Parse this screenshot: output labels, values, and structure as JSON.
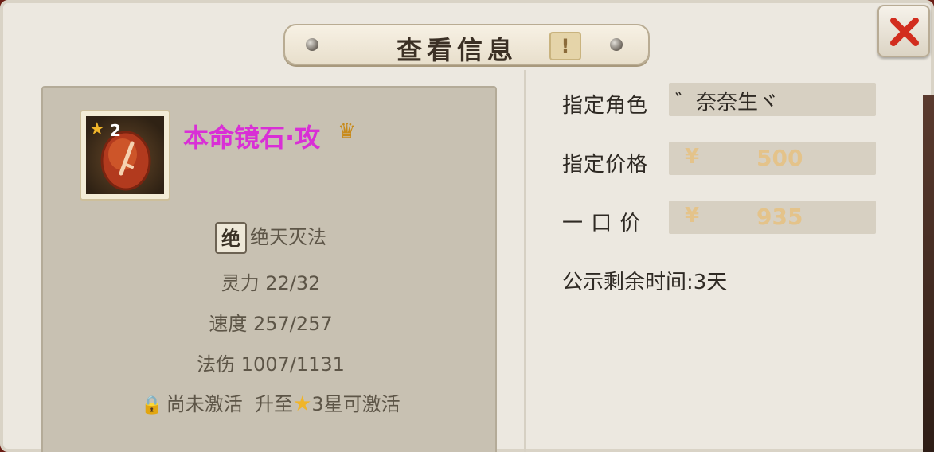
{
  "title": {
    "text": "查看信息",
    "info_symbol": "!"
  },
  "close_button": {
    "symbol": "✕",
    "color": "#d22d1e"
  },
  "item": {
    "name": "本命镜石·攻",
    "name_color": "#d92fd6",
    "star_level": "2",
    "icon": "sword-gem-icon",
    "crown_icon": "crown-icon"
  },
  "skill": {
    "badge": "绝",
    "name": "绝天灭法"
  },
  "stats": {
    "spirit": "灵力 22/32",
    "speed": "速度 257/257",
    "magic_damage": "法伤 1007/1131"
  },
  "activation": {
    "status": "尚未激活",
    "requirement_prefix": "升至",
    "requirement_suffix": "3星可激活"
  },
  "trade": {
    "designated_role_label": "指定角色",
    "designated_role_value": "゛奈奈生ヾ",
    "designated_price_label": "指定价格",
    "designated_price_currency": "¥",
    "designated_price_value": "500",
    "buyout_label": "一 口 价",
    "buyout_currency": "¥",
    "buyout_value": "935",
    "notice_time": "公示剩余时间:3天"
  }
}
